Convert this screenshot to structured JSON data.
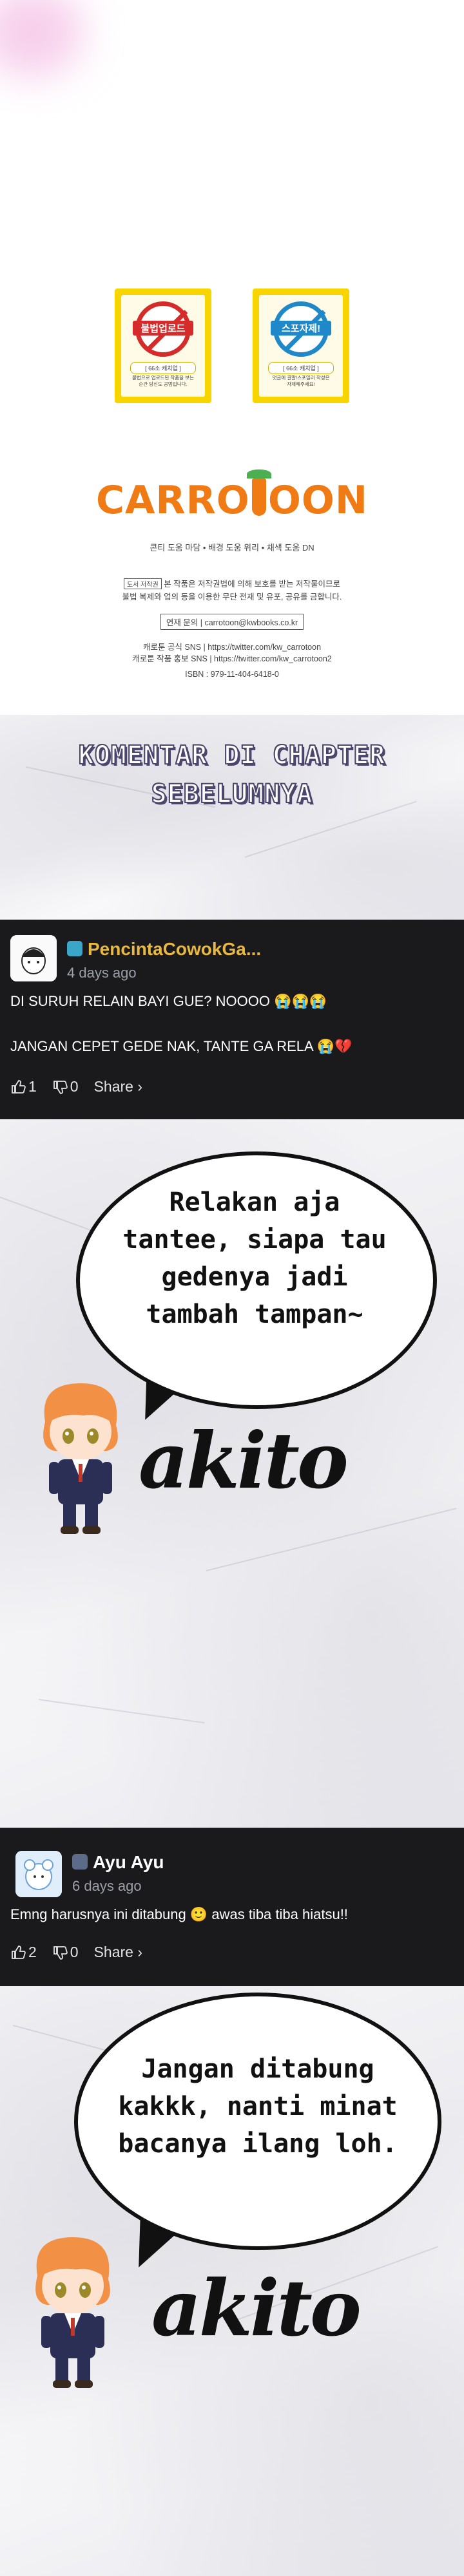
{
  "credits": {
    "notice_left": {
      "title": "불법업로드",
      "sub": "[ 66소 캐치업 ]",
      "desc": [
        "불법으로 업로드된 작품을 보는",
        "순간 당신도 공범입니다."
      ]
    },
    "notice_right": {
      "title": "스포자제!",
      "sub": "[ 66소 캐치업 ]",
      "desc": [
        "댓글에 결말/스포일러 작성은",
        "자제해주세요!"
      ]
    },
    "logo_left": "CARRO",
    "logo_right": "OON",
    "tagline": "콘티 도움 마담  •  배경 도움 위리  •  채색 도움 DN",
    "legal_line1": "본 작품은 저작권법에 의해 보호를 받는 저작물이므로",
    "legal_label": "도서 저작권",
    "legal_line2": "불법 복제와 업의 등을 이용한 무단 전재 및 유포, 공유를 금합니다.",
    "contact": "연재 문의 | carrotoon@kwbooks.co.kr",
    "sns1": "캐로툰 공식 SNS | https://twitter.com/kw_carrotoon",
    "sns2": "캐로툰 작품 홍보 SNS | https://twitter.com/kw_carrotoon2",
    "isbn": "ISBN : 979-11-404-6418-0"
  },
  "heading": {
    "line1": "KOMENTAR DI CHAPTER",
    "line2": "SEBELUMNYA"
  },
  "comment1": {
    "username": "PencintaCowokGa...",
    "time": "4 days ago",
    "line1": "DI SURUH RELAIN BAYI GUE? NOOOO 😭😭😭",
    "line2": "JANGAN CEPET GEDE NAK, TANTE GA RELA 😭💔",
    "likes": "1",
    "dislikes": "0",
    "share": "Share ›",
    "name_color": "#e8b840"
  },
  "panel1": {
    "bubble_lines": [
      "Relakan aja",
      "tantee, siapa tau",
      "gedenya jadi",
      "tambah tampan~"
    ],
    "signature": "akito"
  },
  "comment2": {
    "username": "Ayu Ayu",
    "time": "6 days ago",
    "text": "Emng harusnya ini ditabung 🙂 awas tiba tiba hiatsu!!",
    "likes": "2",
    "dislikes": "0",
    "share": "Share ›",
    "name_color": "#e8e8e8"
  },
  "panel2": {
    "bubble_lines": [
      "Jangan ditabung",
      "kakkk, nanti minat",
      "bacanya ilang loh."
    ],
    "signature": "akito"
  }
}
